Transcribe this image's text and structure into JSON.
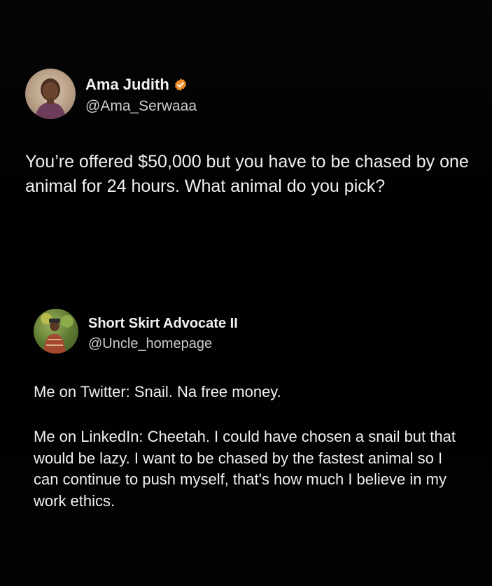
{
  "tweets": [
    {
      "author": {
        "display_name": "Ama Judith",
        "handle": "@Ama_Serwaaa",
        "verified": true,
        "verified_badge_color": "#f28c28",
        "avatar_icon": "profile-photo"
      },
      "text": "You’re offered $50,000 but you have to be chased by one animal for 24 hours. What animal do you pick?"
    },
    {
      "author": {
        "display_name": "Short Skirt Advocate II",
        "handle": "@Uncle_homepage",
        "verified": false,
        "avatar_icon": "profile-photo"
      },
      "paragraphs": [
        "Me on Twitter: Snail. Na free money.",
        "Me on LinkedIn: Cheetah. I could have chosen a snail but that would be lazy. I want to be chased by the fastest animal so I can continue to push myself, that's how much I believe in my work ethics."
      ]
    }
  ],
  "colors": {
    "background": "#000000",
    "text": "#f0f0f0",
    "handle": "#c9cdd1"
  }
}
